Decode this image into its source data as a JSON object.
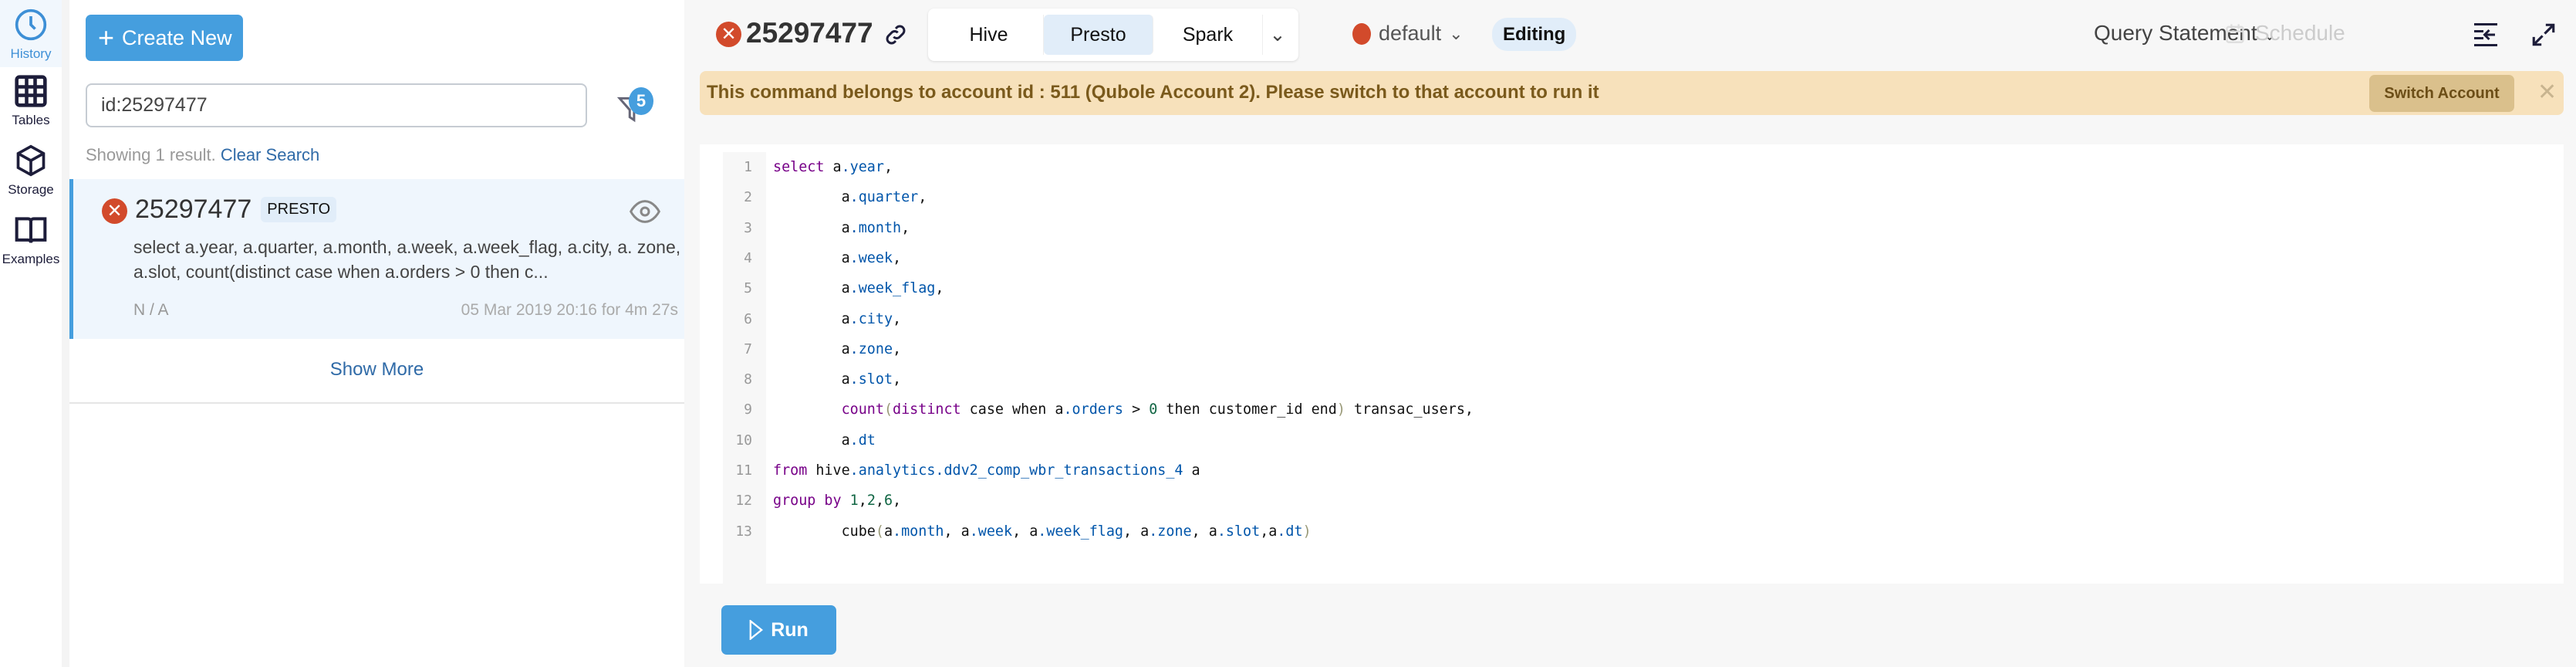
{
  "nav": [
    {
      "label": "History",
      "icon": "clock-icon",
      "active": true
    },
    {
      "label": "Tables",
      "icon": "table-grid-icon"
    },
    {
      "label": "Storage",
      "icon": "cube-icon"
    },
    {
      "label": "Examples",
      "icon": "book-icon"
    }
  ],
  "sidebar": {
    "create_label": "Create New",
    "search_value": "id:25297477",
    "filter_count": "5",
    "showing_text": "Showing 1 result. ",
    "clear_search": "Clear Search",
    "card": {
      "id": "25297477",
      "engine": "PRESTO",
      "query": "select a.year, a.quarter, a.month, a.week, a.week_flag, a.city, a. zone, a.slot, count(distinct case when a.orders > 0 then c...",
      "user": "N / A",
      "time": "05 Mar 2019 20:16 for 4m 27s",
      "status": "failed"
    },
    "show_more": "Show More"
  },
  "header": {
    "title": "25297477",
    "tabs": [
      "Hive",
      "Presto",
      "Spark"
    ],
    "selected_tab": "Presto",
    "cluster": "default",
    "status": "Editing",
    "query_type": "Query Statement",
    "schedule": "Schedule"
  },
  "banner": {
    "message": "This command belongs to account id : 511 (Qubole Account 2). Please switch to that account to run it",
    "button": "Switch Account"
  },
  "editor": {
    "lines": [
      [
        [
          "select",
          "k"
        ],
        [
          " a",
          ""
        ],
        [
          ".year",
          "p"
        ],
        [
          ",",
          ""
        ]
      ],
      [
        [
          "        a",
          ""
        ],
        [
          ".quarter",
          "p"
        ],
        [
          ",",
          ""
        ]
      ],
      [
        [
          "        a",
          ""
        ],
        [
          ".month",
          "p"
        ],
        [
          ",",
          ""
        ]
      ],
      [
        [
          "        a",
          ""
        ],
        [
          ".week",
          "p"
        ],
        [
          ",",
          ""
        ]
      ],
      [
        [
          "        a",
          ""
        ],
        [
          ".week_flag",
          "p"
        ],
        [
          ",",
          ""
        ]
      ],
      [
        [
          "        a",
          ""
        ],
        [
          ".city",
          "p"
        ],
        [
          ",",
          ""
        ]
      ],
      [
        [
          "        a",
          ""
        ],
        [
          ".zone",
          "p"
        ],
        [
          ",",
          ""
        ]
      ],
      [
        [
          "        a",
          ""
        ],
        [
          ".slot",
          "p"
        ],
        [
          ",",
          ""
        ]
      ],
      [
        [
          "        ",
          ""
        ],
        [
          "count",
          "k"
        ],
        [
          "(",
          "b"
        ],
        [
          "distinct",
          "k"
        ],
        [
          " case when a",
          ""
        ],
        [
          ".orders",
          "p"
        ],
        [
          " > ",
          ""
        ],
        [
          "0",
          "n"
        ],
        [
          " then customer_id end",
          ""
        ],
        [
          ")",
          "b"
        ],
        [
          " transac_users,",
          ""
        ]
      ],
      [
        [
          "        a",
          ""
        ],
        [
          ".dt",
          "p"
        ]
      ],
      [
        [
          "from",
          "k"
        ],
        [
          " hive",
          ""
        ],
        [
          ".analytics.ddv2_comp_wbr_transactions_4",
          "p"
        ],
        [
          " a",
          ""
        ]
      ],
      [
        [
          "group by",
          "k"
        ],
        [
          " ",
          ""
        ],
        [
          "1",
          "n"
        ],
        [
          ",",
          ""
        ],
        [
          "2",
          "n"
        ],
        [
          ",",
          ""
        ],
        [
          "6",
          "n"
        ],
        [
          ",",
          ""
        ]
      ],
      [
        [
          "        cube",
          ""
        ],
        [
          "(",
          "b"
        ],
        [
          "a",
          ""
        ],
        [
          ".month",
          "p"
        ],
        [
          ", a",
          ""
        ],
        [
          ".week",
          "p"
        ],
        [
          ", a",
          ""
        ],
        [
          ".week_flag",
          "p"
        ],
        [
          ", a",
          ""
        ],
        [
          ".zone",
          "p"
        ],
        [
          ", a",
          ""
        ],
        [
          ".slot",
          "p"
        ],
        [
          ",a",
          ""
        ],
        [
          ".dt",
          "p"
        ],
        [
          ")",
          "b"
        ]
      ]
    ]
  },
  "run_label": "Run",
  "colors": {
    "accent": "#459ede",
    "error": "#d24a2b",
    "banner": "#f7e1bb"
  }
}
